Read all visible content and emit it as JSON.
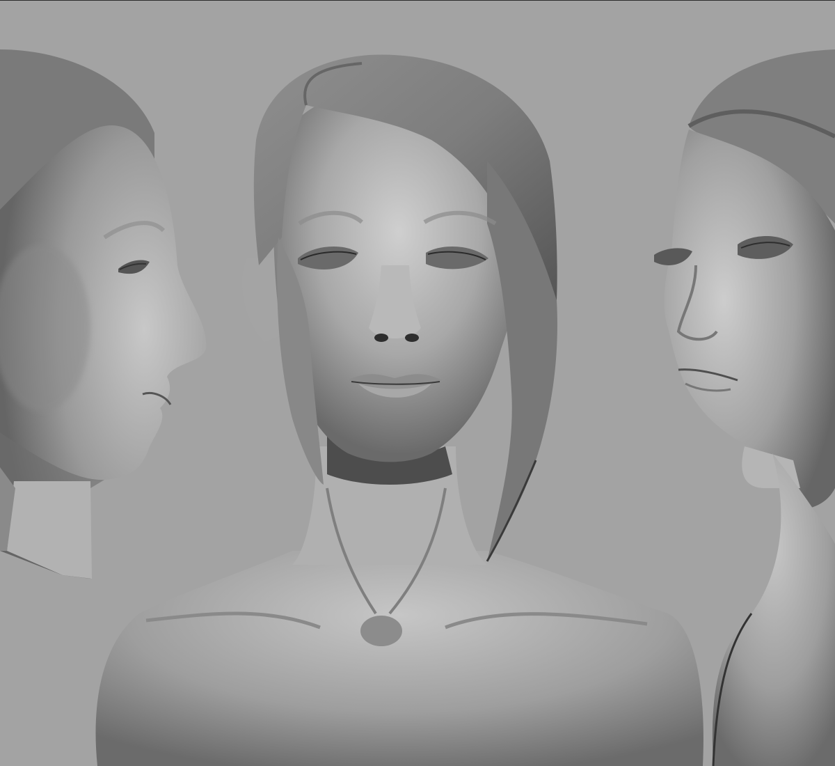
{
  "scene": {
    "background_color": "#a3a3a3",
    "clay_color": "#9c9c9c",
    "clay_highlight": "#cfcfcf",
    "clay_shadow": "#3e3e3e",
    "views": [
      {
        "name": "profile-left"
      },
      {
        "name": "front"
      },
      {
        "name": "three-quarter-right"
      }
    ]
  }
}
